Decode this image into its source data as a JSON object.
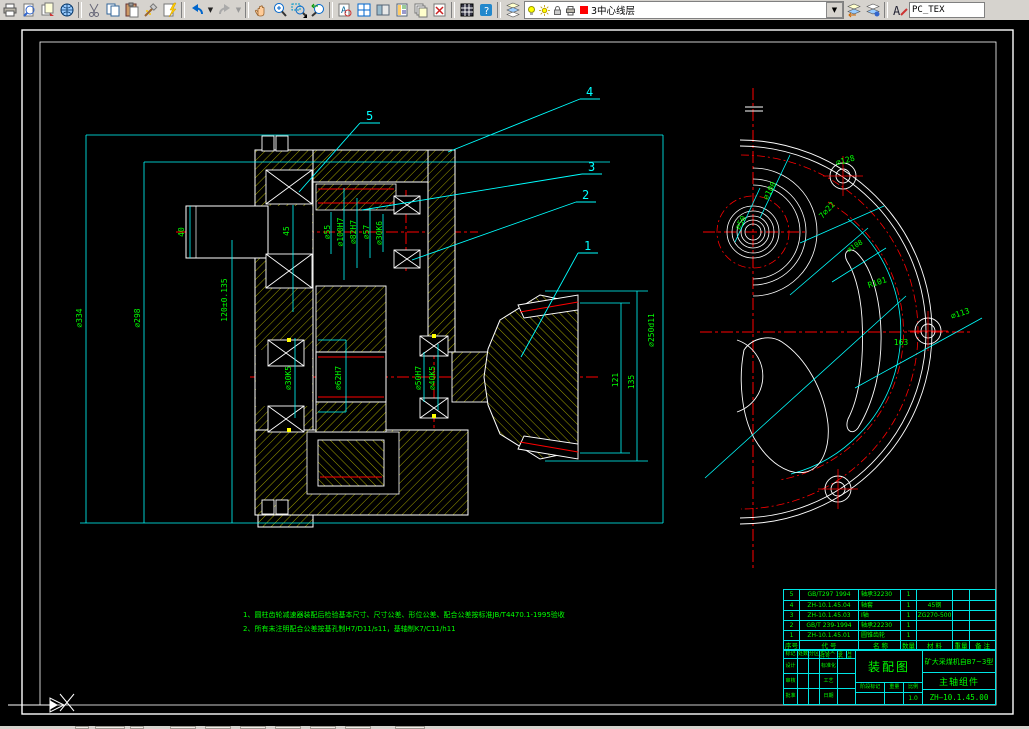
{
  "toolbar": {
    "layer_dropdown": {
      "value": "3中心线层",
      "swatch_color": "#ff0000"
    },
    "style_value": "PC_TEX",
    "icons": [
      "plot",
      "print-preview",
      "publish",
      "web",
      "cut",
      "copy",
      "paste",
      "match-properties",
      "match-lightning",
      "undo",
      "redo",
      "pan",
      "zoom-realtime",
      "zoom-window",
      "zoom-previous",
      "find",
      "properties",
      "designcenter",
      "tool-palettes",
      "sheet-set",
      "markup",
      "calculator",
      "help",
      "layers",
      "layer-previous",
      "layer-states",
      "text-style"
    ]
  },
  "drawing": {
    "callouts": {
      "c1": "1",
      "c2": "2",
      "c3": "3",
      "c4": "4",
      "c5": "5"
    },
    "dims": {
      "d334": "⌀334",
      "d298": "⌀298",
      "len120": "120±0.135",
      "len40": "40",
      "len45": "45",
      "d55": "⌀55",
      "d100h7": "⌀100H7",
      "d82h7": "⌀82H7",
      "d57": "⌀57",
      "d30k6": "⌀30K6",
      "d30k5": "⌀30K5",
      "d62h7": "⌀62H7",
      "d50h7": "⌀50H7",
      "d40k5": "⌀40K5",
      "len121": "121",
      "len135": "135",
      "d250": "⌀250d11",
      "d128": "⌀128",
      "d100": "⌀100",
      "d50": "⌀50",
      "holes": "7⌀22",
      "d108": "⌀108",
      "r101": "R101",
      "len163": "163",
      "d113": "⌀113"
    },
    "notes": [
      "1、圆柱齿轮减速器装配后检验基本尺寸、尺寸公差、形位公差、配合公差按标准JB/T4470.1-1995验收",
      "2、所有未注明配合公差按基孔制H7/D11/s11，基轴制K7/C11/h11"
    ]
  },
  "bom": {
    "headers": [
      "序号",
      "代  号",
      "名  称",
      "数量",
      "材  料",
      "重量",
      "备 注"
    ],
    "rows": [
      {
        "no": "5",
        "code": "GB/T297 1994",
        "name": "轴承32230",
        "qty": "1",
        "mat": "",
        "rem": ""
      },
      {
        "no": "4",
        "code": "ZH-10.1.45.04",
        "name": "轴套",
        "qty": "1",
        "mat": "45钢",
        "rem": ""
      },
      {
        "no": "3",
        "code": "ZH-10.1.45.03",
        "name": "Ⅰ轴",
        "qty": "1",
        "mat": "ZG270-500",
        "rem": ""
      },
      {
        "no": "2",
        "code": "GB/T 239-1994",
        "name": "轴承22230",
        "qty": "1",
        "mat": "",
        "rem": ""
      },
      {
        "no": "1",
        "code": "ZH-10.1.45.01",
        "name": "圆锥齿轮",
        "qty": "1",
        "mat": "",
        "rem": ""
      }
    ]
  },
  "titleblock": {
    "title": "装配图",
    "project": "矿大采煤机自B7~3型",
    "assembly": "主轴组件",
    "code": "ZH—10.1.45.00",
    "scale_value": "1.0",
    "labels": {
      "mark": "标记",
      "count": "处数",
      "zone": "分区",
      "change": "更改文件号",
      "sign": "签名",
      "ymd": "年月日",
      "design": "设计",
      "standard": "标准化",
      "check": "审核",
      "process": "工艺",
      "approve": "批准",
      "stage": "阶段标记",
      "weight": "重量",
      "scale": "比例",
      "date": "日期"
    }
  }
}
